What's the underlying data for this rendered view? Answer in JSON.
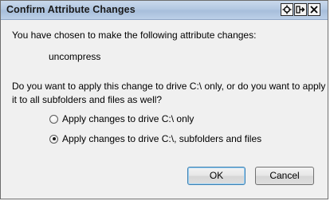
{
  "window": {
    "title": "Confirm Attribute Changes",
    "help_glyph": "?",
    "pin_glyph": "✚",
    "close_glyph": "✕"
  },
  "content": {
    "intro": "You have chosen to make the following attribute changes:",
    "change": "uncompress",
    "question_line1": "Do you want to apply this change to drive C:\\ only, or do you want to apply",
    "question_line2": "it to all subfolders and files as well?"
  },
  "options": [
    {
      "label": "Apply changes to drive C:\\ only",
      "selected": false
    },
    {
      "label": "Apply changes to drive C:\\, subfolders and files",
      "selected": true
    }
  ],
  "buttons": {
    "ok": "OK",
    "cancel": "Cancel"
  }
}
